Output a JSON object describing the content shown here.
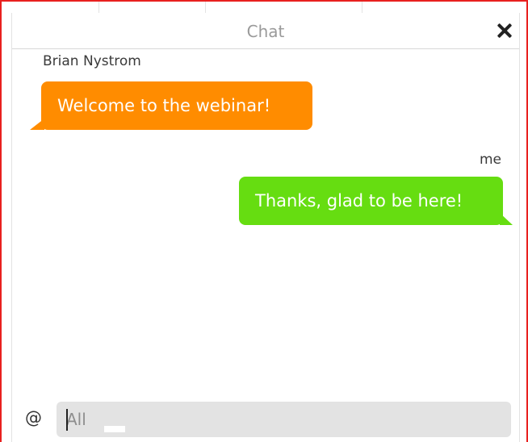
{
  "chat": {
    "title": "Chat",
    "close_icon": "close-icon",
    "messages": [
      {
        "sender": "Brian Nystrom",
        "text": "Welcome to the webinar!",
        "direction": "incoming",
        "color": "#ff8c00"
      },
      {
        "sender": "me",
        "text": "Thanks, glad to be here!",
        "direction": "outgoing",
        "color": "#66dd11"
      }
    ],
    "input": {
      "at_symbol": "@",
      "placeholder": "All",
      "value": ""
    }
  },
  "colors": {
    "frame_border": "#e8201f",
    "incoming_bubble": "#ff8c00",
    "outgoing_bubble": "#66dd11",
    "input_background": "#e3e3e3"
  }
}
